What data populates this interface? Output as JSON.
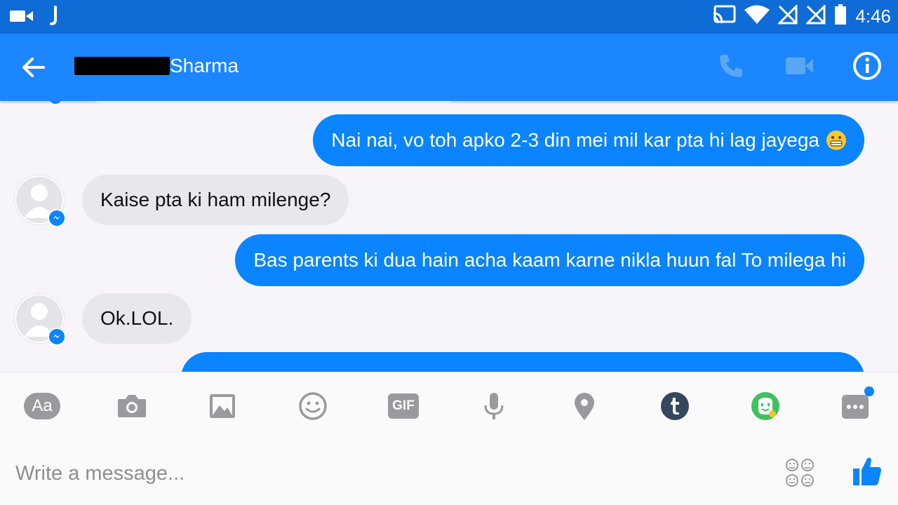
{
  "status_bar": {
    "time": "4:46",
    "icons": [
      "video-camera-icon",
      "notification-j-icon",
      "cast-icon",
      "wifi-icon",
      "no-signal-icon",
      "no-signal-icon",
      "battery-icon"
    ]
  },
  "header": {
    "back_icon": "arrow-left-icon",
    "contact_name": "Sharma",
    "actions": [
      "phone-icon",
      "video-call-icon",
      "info-icon"
    ]
  },
  "messages": [
    {
      "direction": "outgoing",
      "text": "Nai nai, vo toh apko 2-3 din mei mil kar pta hi lag jayega",
      "emoji": "grinning-face"
    },
    {
      "direction": "incoming",
      "text": "Kaise pta ki ham milenge?"
    },
    {
      "direction": "outgoing",
      "text": "Bas parents ki dua hain acha kaam karne nikla huun fal To milega hi"
    },
    {
      "direction": "incoming",
      "text": "Ok.LOL."
    }
  ],
  "toolbar": {
    "text_label": "Aa",
    "gif_label": "GIF",
    "tools": [
      "text-format-icon",
      "camera-icon",
      "image-icon",
      "emoji-icon",
      "gif-icon",
      "microphone-icon",
      "location-icon",
      "tumblr-icon",
      "bitmoji-icon",
      "more-icon"
    ]
  },
  "composer": {
    "placeholder": "Write a message...",
    "stickers_icon": "stickers-icon",
    "like_icon": "thumbs-up-icon"
  },
  "colors": {
    "status_bar": "#0f6bd6",
    "header": "#1b86ff",
    "outgoing_bubble": "#0a84ff",
    "incoming_bubble": "#e9e7ee"
  }
}
